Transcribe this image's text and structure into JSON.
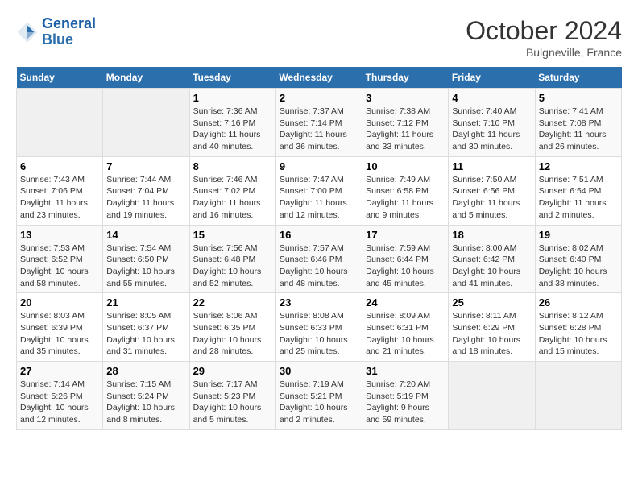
{
  "header": {
    "logo_line1": "General",
    "logo_line2": "Blue",
    "month_title": "October 2024",
    "subtitle": "Bulgneville, France"
  },
  "days_of_week": [
    "Sunday",
    "Monday",
    "Tuesday",
    "Wednesday",
    "Thursday",
    "Friday",
    "Saturday"
  ],
  "weeks": [
    [
      {
        "day": "",
        "info": ""
      },
      {
        "day": "",
        "info": ""
      },
      {
        "day": "1",
        "info": "Sunrise: 7:36 AM\nSunset: 7:16 PM\nDaylight: 11 hours and 40 minutes."
      },
      {
        "day": "2",
        "info": "Sunrise: 7:37 AM\nSunset: 7:14 PM\nDaylight: 11 hours and 36 minutes."
      },
      {
        "day": "3",
        "info": "Sunrise: 7:38 AM\nSunset: 7:12 PM\nDaylight: 11 hours and 33 minutes."
      },
      {
        "day": "4",
        "info": "Sunrise: 7:40 AM\nSunset: 7:10 PM\nDaylight: 11 hours and 30 minutes."
      },
      {
        "day": "5",
        "info": "Sunrise: 7:41 AM\nSunset: 7:08 PM\nDaylight: 11 hours and 26 minutes."
      }
    ],
    [
      {
        "day": "6",
        "info": "Sunrise: 7:43 AM\nSunset: 7:06 PM\nDaylight: 11 hours and 23 minutes."
      },
      {
        "day": "7",
        "info": "Sunrise: 7:44 AM\nSunset: 7:04 PM\nDaylight: 11 hours and 19 minutes."
      },
      {
        "day": "8",
        "info": "Sunrise: 7:46 AM\nSunset: 7:02 PM\nDaylight: 11 hours and 16 minutes."
      },
      {
        "day": "9",
        "info": "Sunrise: 7:47 AM\nSunset: 7:00 PM\nDaylight: 11 hours and 12 minutes."
      },
      {
        "day": "10",
        "info": "Sunrise: 7:49 AM\nSunset: 6:58 PM\nDaylight: 11 hours and 9 minutes."
      },
      {
        "day": "11",
        "info": "Sunrise: 7:50 AM\nSunset: 6:56 PM\nDaylight: 11 hours and 5 minutes."
      },
      {
        "day": "12",
        "info": "Sunrise: 7:51 AM\nSunset: 6:54 PM\nDaylight: 11 hours and 2 minutes."
      }
    ],
    [
      {
        "day": "13",
        "info": "Sunrise: 7:53 AM\nSunset: 6:52 PM\nDaylight: 10 hours and 58 minutes."
      },
      {
        "day": "14",
        "info": "Sunrise: 7:54 AM\nSunset: 6:50 PM\nDaylight: 10 hours and 55 minutes."
      },
      {
        "day": "15",
        "info": "Sunrise: 7:56 AM\nSunset: 6:48 PM\nDaylight: 10 hours and 52 minutes."
      },
      {
        "day": "16",
        "info": "Sunrise: 7:57 AM\nSunset: 6:46 PM\nDaylight: 10 hours and 48 minutes."
      },
      {
        "day": "17",
        "info": "Sunrise: 7:59 AM\nSunset: 6:44 PM\nDaylight: 10 hours and 45 minutes."
      },
      {
        "day": "18",
        "info": "Sunrise: 8:00 AM\nSunset: 6:42 PM\nDaylight: 10 hours and 41 minutes."
      },
      {
        "day": "19",
        "info": "Sunrise: 8:02 AM\nSunset: 6:40 PM\nDaylight: 10 hours and 38 minutes."
      }
    ],
    [
      {
        "day": "20",
        "info": "Sunrise: 8:03 AM\nSunset: 6:39 PM\nDaylight: 10 hours and 35 minutes."
      },
      {
        "day": "21",
        "info": "Sunrise: 8:05 AM\nSunset: 6:37 PM\nDaylight: 10 hours and 31 minutes."
      },
      {
        "day": "22",
        "info": "Sunrise: 8:06 AM\nSunset: 6:35 PM\nDaylight: 10 hours and 28 minutes."
      },
      {
        "day": "23",
        "info": "Sunrise: 8:08 AM\nSunset: 6:33 PM\nDaylight: 10 hours and 25 minutes."
      },
      {
        "day": "24",
        "info": "Sunrise: 8:09 AM\nSunset: 6:31 PM\nDaylight: 10 hours and 21 minutes."
      },
      {
        "day": "25",
        "info": "Sunrise: 8:11 AM\nSunset: 6:29 PM\nDaylight: 10 hours and 18 minutes."
      },
      {
        "day": "26",
        "info": "Sunrise: 8:12 AM\nSunset: 6:28 PM\nDaylight: 10 hours and 15 minutes."
      }
    ],
    [
      {
        "day": "27",
        "info": "Sunrise: 7:14 AM\nSunset: 5:26 PM\nDaylight: 10 hours and 12 minutes."
      },
      {
        "day": "28",
        "info": "Sunrise: 7:15 AM\nSunset: 5:24 PM\nDaylight: 10 hours and 8 minutes."
      },
      {
        "day": "29",
        "info": "Sunrise: 7:17 AM\nSunset: 5:23 PM\nDaylight: 10 hours and 5 minutes."
      },
      {
        "day": "30",
        "info": "Sunrise: 7:19 AM\nSunset: 5:21 PM\nDaylight: 10 hours and 2 minutes."
      },
      {
        "day": "31",
        "info": "Sunrise: 7:20 AM\nSunset: 5:19 PM\nDaylight: 9 hours and 59 minutes."
      },
      {
        "day": "",
        "info": ""
      },
      {
        "day": "",
        "info": ""
      }
    ]
  ]
}
